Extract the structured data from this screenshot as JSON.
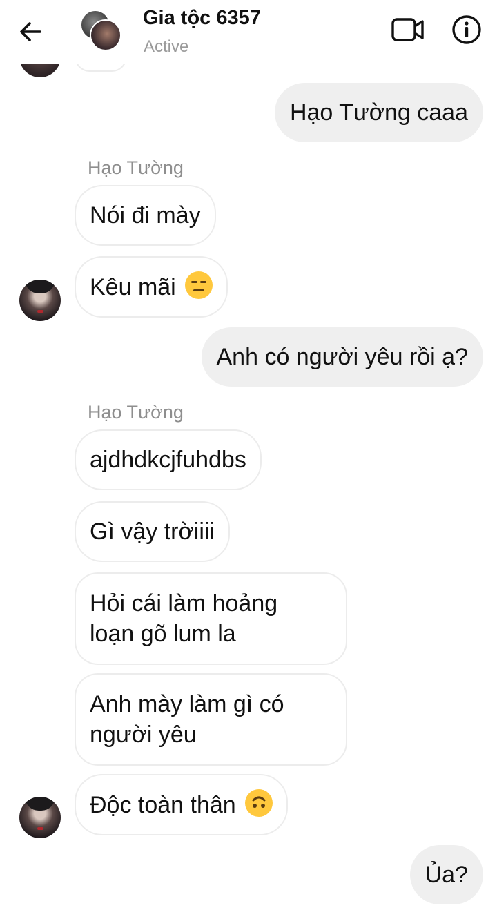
{
  "header": {
    "title": "Gia tộc 6357",
    "status": "Active",
    "icons": {
      "back": "back-arrow-icon",
      "video": "video-call-icon",
      "info": "info-icon"
    }
  },
  "messages": [
    {
      "type": "outgoing",
      "text": "Hạo Tường caaa"
    },
    {
      "type": "sender",
      "text": "Hạo Tường"
    },
    {
      "type": "incoming",
      "text": "Nói đi mày"
    },
    {
      "type": "incoming",
      "text": "Kêu mãi",
      "emoji": "expressionless-face-emoji"
    },
    {
      "type": "outgoing",
      "text": "Anh có người yêu rồi ạ?"
    },
    {
      "type": "sender",
      "text": "Hạo Tường"
    },
    {
      "type": "incoming",
      "text": "ajdhdkcjfuhdbs"
    },
    {
      "type": "incoming",
      "text": "Gì vậy trờiiii"
    },
    {
      "type": "incoming",
      "line1": "Hỏi cái làm hoảng",
      "line2": "loạn gõ lum la"
    },
    {
      "type": "incoming",
      "line1": "Anh mày làm gì có",
      "line2": "người yêu"
    },
    {
      "type": "incoming",
      "text": "Độc toàn thân",
      "emoji": "upside-down-face-emoji"
    },
    {
      "type": "outgoing",
      "text": "Ủa?"
    }
  ],
  "colors": {
    "outgoing_bubble": "#efefef",
    "incoming_border": "#ececec",
    "muted_text": "#8e8e8e",
    "emoji": "#ffc83d"
  }
}
